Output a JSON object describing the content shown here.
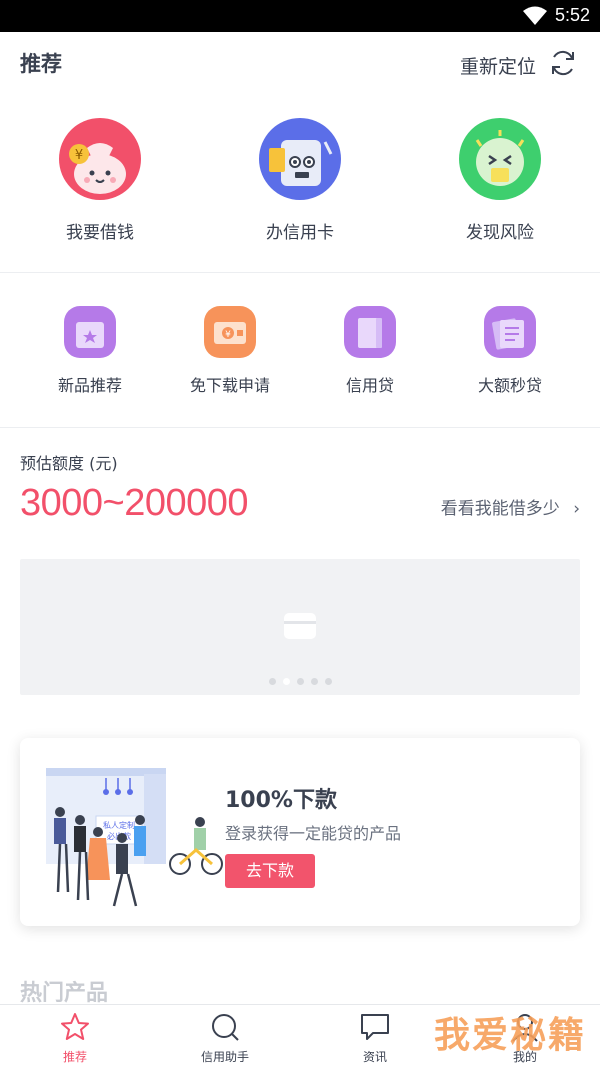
{
  "status_bar": {
    "time": "5:52"
  },
  "header": {
    "title": "推荐",
    "relocate_label": "重新定位"
  },
  "big_icons": [
    {
      "label": "我要借钱",
      "icon": "money-bag-icon",
      "color": "#f2506a"
    },
    {
      "label": "办信用卡",
      "icon": "credit-card-monster-icon",
      "color": "#5b6ee8"
    },
    {
      "label": "发现风险",
      "icon": "risk-face-icon",
      "color": "#3ecf6e"
    }
  ],
  "small_icons": [
    {
      "label": "新品推荐",
      "icon": "star-box-icon",
      "color": "#b57ae8"
    },
    {
      "label": "免下载申请",
      "icon": "wallet-icon",
      "color": "#f7935a"
    },
    {
      "label": "信用贷",
      "icon": "book-icon",
      "color": "#b57ae8"
    },
    {
      "label": "大额秒贷",
      "icon": "document-icon",
      "color": "#b57ae8"
    }
  ],
  "estimate": {
    "label": "预估额度 (元)",
    "amount": "3000~200000",
    "link_label": "看看我能借多少"
  },
  "banner": {
    "dot_count": 5,
    "active_dot": 1
  },
  "promo": {
    "title": "100%下款",
    "subtitle": "登录获得一定能贷的产品",
    "button_label": "去下款",
    "illustration_text_1": "私人定制",
    "illustration_text_2": "必出款"
  },
  "hot_section": {
    "title": "热门产品"
  },
  "tabs": [
    {
      "label": "推荐",
      "icon": "star-icon",
      "active": true
    },
    {
      "label": "信用助手",
      "icon": "search-icon",
      "active": false
    },
    {
      "label": "资讯",
      "icon": "chat-bubble-icon",
      "active": false
    },
    {
      "label": "我的",
      "icon": "person-icon",
      "active": false
    }
  ],
  "watermark": "我爱秘籍",
  "colors": {
    "accent": "#f2506a",
    "text": "#3a4150"
  }
}
